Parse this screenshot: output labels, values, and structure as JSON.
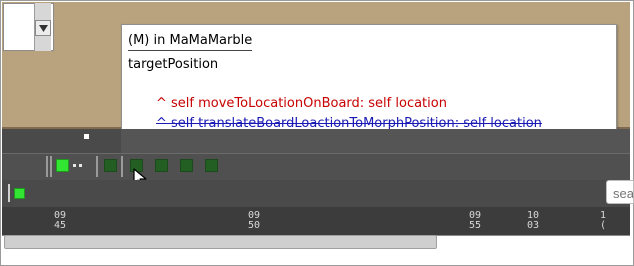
{
  "tooltip": {
    "title": "(M) in MaMaMarble",
    "selector": "targetPosition",
    "senders": [
      "^ self moveToLocationOnBoard: self location",
      "^ self translateBoardLoactionToMorphPosition: self location"
    ]
  },
  "search": {
    "placeholder": "sea"
  },
  "timeline": {
    "ticks": [
      {
        "top": "09",
        "bottom": "45"
      },
      {
        "top": "09",
        "bottom": "50"
      },
      {
        "top": "09",
        "bottom": "55"
      },
      {
        "top": "10",
        "bottom": "03"
      },
      {
        "top": "1",
        "bottom": "("
      }
    ]
  },
  "scrollbar": {
    "position_fraction": 0.0,
    "visible_fraction": 0.69
  },
  "colors": {
    "board": "#b9a37f",
    "sender_red": "#c80000",
    "sender_blue": "#1a1ab4",
    "bright_green": "#33e533",
    "dark_green": "#235f23"
  },
  "icons": {
    "pane_menu": "triangle-down-icon",
    "cursor": "mouse-pointer-icon"
  }
}
